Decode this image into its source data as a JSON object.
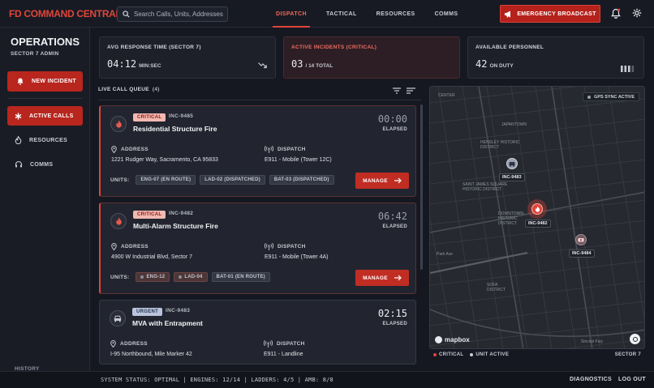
{
  "app": {
    "title": "FD COMMAND CENTRAL"
  },
  "search": {
    "placeholder": "Search Calls, Units, Addresses"
  },
  "nav": {
    "tabs": [
      {
        "label": "DISPATCH",
        "active": true
      },
      {
        "label": "TACTICAL"
      },
      {
        "label": "RESOURCES"
      },
      {
        "label": "COMMS"
      }
    ]
  },
  "header": {
    "emergency_label": "EMERGENCY BROADCAST"
  },
  "sidebar": {
    "title": "OPERATIONS",
    "subtitle": "SECTOR 7 ADMIN",
    "new_incident": "NEW INCIDENT",
    "items": [
      {
        "label": "ACTIVE CALLS",
        "icon": "asterisk-icon",
        "active": true
      },
      {
        "label": "RESOURCES",
        "icon": "fire-icon"
      },
      {
        "label": "COMMS",
        "icon": "headset-icon"
      }
    ],
    "history": "HISTORY"
  },
  "stats": [
    {
      "label": "AVG RESPONSE TIME (SECTOR 7)",
      "value": "04:12",
      "unit": "MIN:SEC"
    },
    {
      "label": "ACTIVE INCIDENTS (CRITICAL)",
      "value": "03",
      "unit": "/ 14 TOTAL"
    },
    {
      "label": "AVAILABLE PERSONNEL",
      "value": "42",
      "unit": "ON DUTY"
    }
  ],
  "queue": {
    "title": "LIVE CALL QUEUE",
    "count": "(4)",
    "address_label": "ADDRESS",
    "dispatch_label": "DISPATCH",
    "units_label": "UNITS:",
    "elapsed_label": "ELAPSED",
    "manage_label": "MANAGE",
    "cards": [
      {
        "priority": "CRITICAL",
        "id": "INC-9485",
        "title": "Residential Structure Fire",
        "timer": "00:00",
        "address": "1221 Rudger Way, Sacramento, CA 95833",
        "dispatch": "E911 - Mobile (Tower 12C)",
        "units": [
          "ENG-07 (EN ROUTE)",
          "LAD-02 (DISPATCHED)",
          "BAT-03 (DISPATCHED)"
        ]
      },
      {
        "priority": "CRITICAL",
        "id": "INC-9482",
        "title": "Multi-Alarm Structure Fire",
        "timer": "06:42",
        "address": "4900 W Industrial Blvd, Sector 7",
        "dispatch": "E911 - Mobile (Tower 4A)",
        "units": [
          "ENG-12",
          "LAD-04",
          "BAT-01 (EN ROUTE)"
        ]
      },
      {
        "priority": "URGENT",
        "id": "INC-9483",
        "title": "MVA with Entrapment",
        "timer": "02:15",
        "address": "I-95 Northbound, Mile Marker 42",
        "dispatch": "E911 - Landline"
      }
    ]
  },
  "map": {
    "gps_status": "GPS SYNC ACTIVE",
    "markers": [
      "INC-9483",
      "INC-9482",
      "INC-9484"
    ],
    "streets": [
      "CENTER",
      "JAPANTOWN",
      "HENSLEY HISTORIC DISTRICT",
      "SAINT JAMES SQUARE HISTORIC DISTRICT",
      "DOWNTOWN HISTORIC DISTRICT",
      "SOFA DISTRICT",
      "Park Ave",
      "Sinclair Fwy"
    ],
    "legend": {
      "critical": "CRITICAL",
      "unit": "UNIT ACTIVE",
      "sector": "SECTOR 7"
    },
    "attribution": "mapbox"
  },
  "footer": {
    "status": "SYSTEM STATUS: OPTIMAL | ENGINES: 12/14 | LADDERS: 4/5 | AMB: 8/8",
    "diagnostics": "DIAGNOSTICS",
    "logout": "LOG OUT"
  },
  "colors": {
    "accent": "#e0453a",
    "button": "#c12d23",
    "background": "#151821"
  }
}
